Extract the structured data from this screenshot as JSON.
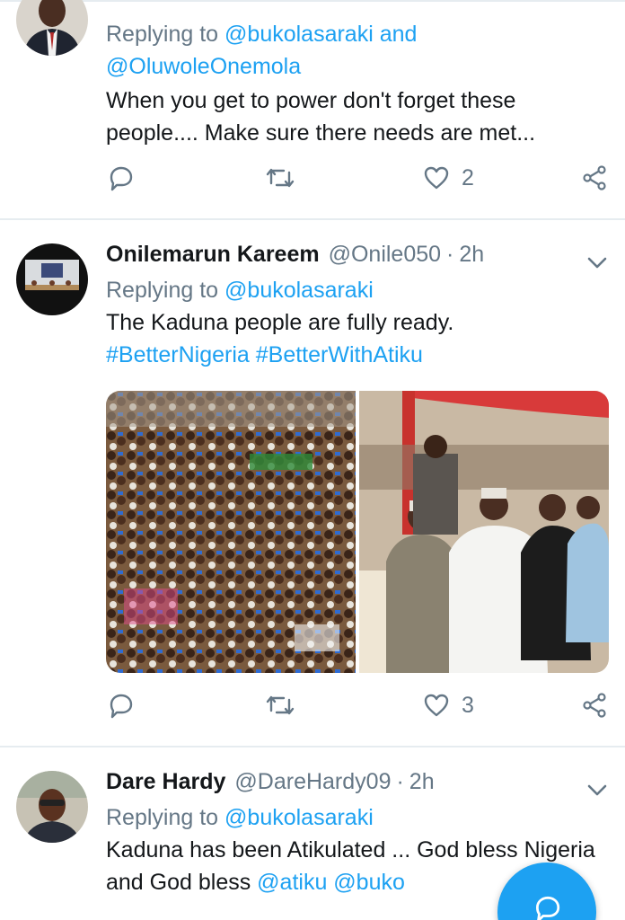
{
  "tweets": [
    {
      "avatar_icon": "person-in-suit-avatar",
      "replying_prefix": "Replying to",
      "replying_handles": "@bukolasaraki and @OluwoleOnemola",
      "text": "When you get to power don't forget these people.... Make sure there needs are met...",
      "reply_count": "",
      "retweet_count": "",
      "like_count": "2"
    },
    {
      "name": "Onilemarun Kareem",
      "handle": "@Onile050",
      "separator": "·",
      "time": "2h",
      "avatar_icon": "meeting-room-avatar",
      "replying_prefix": "Replying to",
      "replying_handles": "@bukolasaraki",
      "text": "The Kaduna people are fully ready.",
      "hashtags": "#BetterNigeria #BetterWithAtiku",
      "media": [
        "rally-crowd-photo",
        "seated-dignitaries-photo"
      ],
      "reply_count": "",
      "retweet_count": "",
      "like_count": "3"
    },
    {
      "name": "Dare Hardy",
      "handle": "@DareHardy09",
      "separator": "·",
      "time": "2h",
      "avatar_icon": "young-man-avatar",
      "replying_prefix": "Replying to",
      "replying_handles": "@bukolasaraki",
      "text_plain": "Kaduna has been Atikulated ... God bless Nigeria and God bless ",
      "text_mentions": "@atiku @buko"
    }
  ],
  "icons": {
    "reply": "reply-icon",
    "retweet": "retweet-icon",
    "like": "heart-icon",
    "share": "share-icon",
    "more": "chevron-down-icon",
    "compose": "compose-fab"
  },
  "colors": {
    "accent": "#1da1f2",
    "secondary_text": "#657786",
    "divider": "#e6ecf0"
  }
}
